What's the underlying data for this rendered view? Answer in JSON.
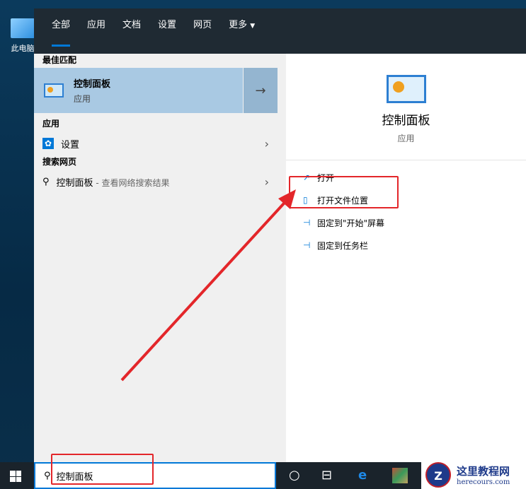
{
  "desktop": {
    "icon_label": "此电脑"
  },
  "tabs": [
    "全部",
    "应用",
    "文档",
    "设置",
    "网页",
    "更多"
  ],
  "left": {
    "best_match_heading": "最佳匹配",
    "best_match": {
      "title": "控制面板",
      "subtitle": "应用"
    },
    "apps_heading": "应用",
    "apps": [
      {
        "label": "设置"
      }
    ],
    "web_heading": "搜索网页",
    "web": {
      "label": "控制面板",
      "suffix": " - 查看网络搜索结果"
    }
  },
  "right": {
    "title": "控制面板",
    "subtitle": "应用",
    "actions": [
      "打开",
      "打开文件位置",
      "固定到\"开始\"屏幕",
      "固定到任务栏"
    ]
  },
  "search": {
    "value": "控制面板"
  },
  "watermark": {
    "title": "这里教程网",
    "url": "herecours.com",
    "letter": "Z"
  }
}
